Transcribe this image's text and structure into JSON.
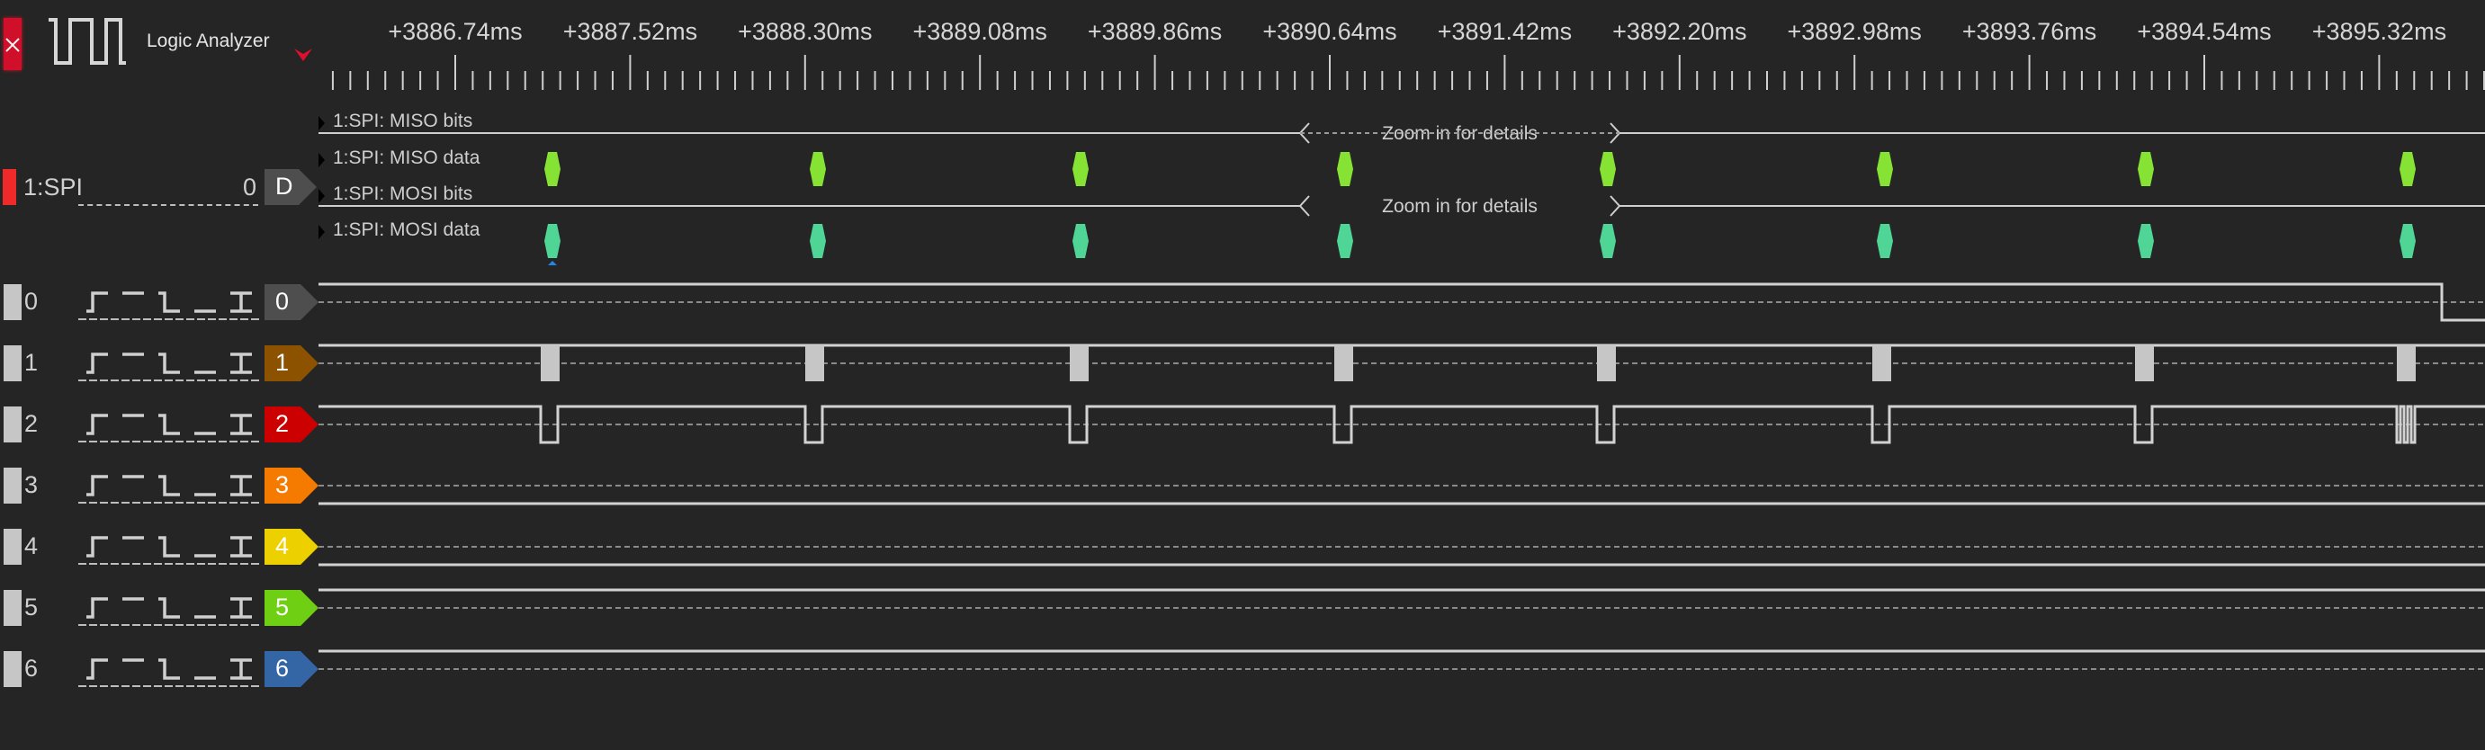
{
  "header": {
    "title": "Logic Analyzer",
    "close_icon": "close-icon",
    "logo_icon": "square-wave-icon",
    "menu_icon": "chevron-down-icon",
    "accent_color": "#d0102a"
  },
  "ruler": {
    "labels": [
      "+3886.74ms",
      "+3887.52ms",
      "+3888.30ms",
      "+3889.08ms",
      "+3889.86ms",
      "+3890.64ms",
      "+3891.42ms",
      "+3892.20ms",
      "+3893.76ms",
      "+3892.98ms",
      "+3894.54ms",
      "+3895.32ms",
      "+"
    ],
    "ordered_labels": [
      "+3886.74ms",
      "+3887.52ms",
      "+3888.30ms",
      "+3889.08ms",
      "+3889.86ms",
      "+3890.64ms",
      "+3891.42ms",
      "+3892.20ms",
      "+3892.98ms",
      "+3893.76ms",
      "+3894.54ms",
      "+3895.32ms",
      "+"
    ],
    "major_step_ms": 0.78,
    "minor_divisions": 10
  },
  "analyzer": {
    "name": "1:SPI",
    "value": "0",
    "tag": "D",
    "color": "#f02a2a",
    "tag_color": "#4e4e4e",
    "rows": [
      {
        "label": "1:SPI: MISO bits",
        "kind": "bits",
        "zoom_text": "Zoom in for details",
        "dashed_gap": true
      },
      {
        "label": "1:SPI: MISO data",
        "kind": "data",
        "marker_color": "#86e334"
      },
      {
        "label": "1:SPI: MOSI bits",
        "kind": "bits",
        "zoom_text": "Zoom in for details",
        "dashed_gap": false
      },
      {
        "label": "1:SPI: MOSI data",
        "kind": "data",
        "marker_color": "#4fd596"
      }
    ],
    "frame_count_visible": 8
  },
  "trigger_symbols": [
    "rising-edge-icon",
    "high-level-icon",
    "falling-edge-icon",
    "low-level-icon",
    "either-edge-icon"
  ],
  "channels": [
    {
      "num": "0",
      "tag": "0",
      "color": "#4e4e4e",
      "level": "high",
      "transition": "falls-near-end"
    },
    {
      "num": "1",
      "tag": "1",
      "color": "#8c5200",
      "level": "high",
      "activity": "burst"
    },
    {
      "num": "2",
      "tag": "2",
      "color": "#cc0000",
      "level": "high",
      "activity": "low-pulse"
    },
    {
      "num": "3",
      "tag": "3",
      "color": "#f57a00",
      "level": "low"
    },
    {
      "num": "4",
      "tag": "4",
      "color": "#ecd000",
      "level": "low"
    },
    {
      "num": "5",
      "tag": "5",
      "color": "#6fcf12",
      "level": "high"
    },
    {
      "num": "6",
      "tag": "6",
      "color": "#3465a4",
      "level": "high"
    }
  ]
}
